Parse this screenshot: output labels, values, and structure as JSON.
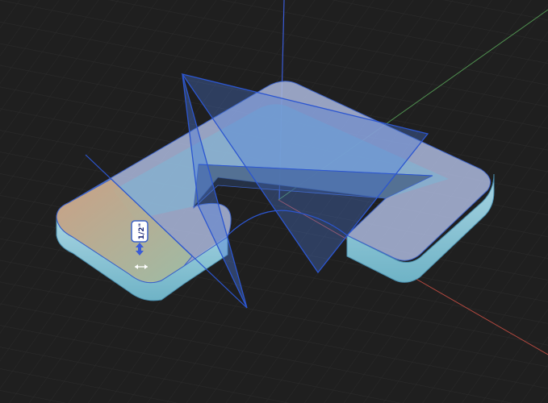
{
  "viewport": {
    "background": "#1f1f1f",
    "grid_color": "#2c2c2c",
    "axis_colors": {
      "x": "#b3483f",
      "y": "#4f8f4f",
      "z": "#3a5bd6"
    }
  },
  "model": {
    "top_color": "#a9b5d8",
    "side_color": "#8fc4d6",
    "selected_face_color": "#c9b98f",
    "plane_color": "#4a78d8"
  },
  "dimension": {
    "label": "1/2\"",
    "arrow_icon": "double-arrow-vertical-icon",
    "resize_icon": "horizontal-resize-icon"
  }
}
